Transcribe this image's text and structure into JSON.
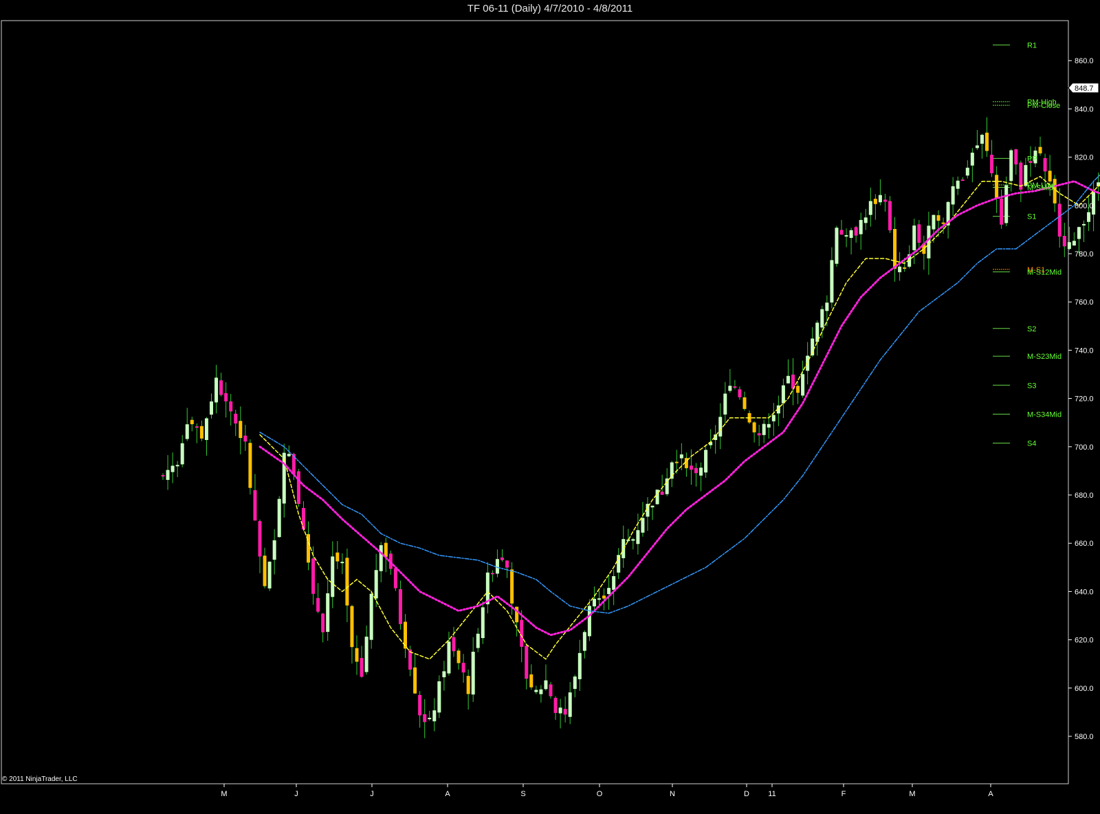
{
  "window": {
    "title": "TF 06-11 (Daily)  4/7/2010 - 4/8/2011",
    "copyright": "© 2011 NinjaTrader, LLC"
  },
  "colors": {
    "background": "#000000",
    "up_candle": "#c8ffc0",
    "down_candle_orange": "#ffc000",
    "down_candle_magenta": "#ff1ca8",
    "wick": "#33cc33",
    "sma_fast": "#ffff33",
    "sma_mid": "#ff22dd",
    "sma_slow": "#3399ff",
    "level_line": "#66dd44",
    "level_label": "#66ff33",
    "axis": "#ffffff"
  },
  "chart_data": {
    "type": "candlestick",
    "ylim": [
      570,
      878
    ],
    "y_ticks": [
      "580.0",
      "600.0",
      "620.0",
      "640.0",
      "660.0",
      "680.0",
      "700.0",
      "720.0",
      "740.0",
      "760.0",
      "780.0",
      "800.0",
      "820.0",
      "840.0",
      "860.0"
    ],
    "x_ticks": [
      "M",
      "J",
      "J",
      "A",
      "S",
      "O",
      "N",
      "D",
      "11",
      "F",
      "M",
      "A"
    ],
    "last_price": "848.7",
    "price_path": [
      [
        0,
        688
      ],
      [
        3,
        695
      ],
      [
        5,
        712
      ],
      [
        8,
        705
      ],
      [
        11,
        728
      ],
      [
        14,
        715
      ],
      [
        17,
        700
      ],
      [
        19,
        668
      ],
      [
        21,
        640
      ],
      [
        23,
        660
      ],
      [
        25,
        700
      ],
      [
        27,
        690
      ],
      [
        29,
        665
      ],
      [
        31,
        640
      ],
      [
        33,
        625
      ],
      [
        35,
        655
      ],
      [
        37,
        650
      ],
      [
        39,
        615
      ],
      [
        41,
        605
      ],
      [
        43,
        638
      ],
      [
        45,
        662
      ],
      [
        47,
        650
      ],
      [
        49,
        628
      ],
      [
        51,
        610
      ],
      [
        53,
        590
      ],
      [
        55,
        585
      ],
      [
        57,
        600
      ],
      [
        59,
        618
      ],
      [
        61,
        610
      ],
      [
        63,
        600
      ],
      [
        65,
        625
      ],
      [
        67,
        645
      ],
      [
        69,
        655
      ],
      [
        71,
        650
      ],
      [
        73,
        625
      ],
      [
        75,
        605
      ],
      [
        77,
        598
      ],
      [
        79,
        603
      ],
      [
        81,
        592
      ],
      [
        83,
        588
      ],
      [
        85,
        605
      ],
      [
        87,
        625
      ],
      [
        89,
        640
      ],
      [
        91,
        640
      ],
      [
        93,
        648
      ],
      [
        95,
        660
      ],
      [
        97,
        662
      ],
      [
        99,
        672
      ],
      [
        101,
        678
      ],
      [
        103,
        682
      ],
      [
        105,
        695
      ],
      [
        107,
        698
      ],
      [
        109,
        690
      ],
      [
        111,
        692
      ],
      [
        113,
        700
      ],
      [
        115,
        712
      ],
      [
        117,
        728
      ],
      [
        119,
        722
      ],
      [
        121,
        712
      ],
      [
        123,
        702
      ],
      [
        125,
        712
      ],
      [
        127,
        718
      ],
      [
        129,
        728
      ],
      [
        131,
        725
      ],
      [
        133,
        740
      ],
      [
        135,
        750
      ],
      [
        137,
        762
      ],
      [
        139,
        792
      ],
      [
        141,
        785
      ],
      [
        143,
        790
      ],
      [
        145,
        797
      ],
      [
        147,
        803
      ],
      [
        149,
        800
      ],
      [
        151,
        775
      ],
      [
        153,
        772
      ],
      [
        155,
        790
      ],
      [
        157,
        780
      ],
      [
        159,
        798
      ],
      [
        161,
        795
      ],
      [
        163,
        808
      ],
      [
        165,
        812
      ],
      [
        167,
        822
      ],
      [
        169,
        828
      ],
      [
        171,
        815
      ],
      [
        173,
        795
      ],
      [
        175,
        822
      ],
      [
        177,
        808
      ],
      [
        179,
        820
      ],
      [
        181,
        822
      ],
      [
        183,
        808
      ],
      [
        185,
        790
      ],
      [
        187,
        782
      ],
      [
        189,
        792
      ],
      [
        191,
        798
      ],
      [
        193,
        810
      ],
      [
        195,
        822
      ],
      [
        197,
        833
      ],
      [
        199,
        842
      ],
      [
        201,
        848
      ],
      [
        202,
        848.7
      ]
    ],
    "series": [
      {
        "name": "",
        "style": "dashed",
        "color": "#ffff33",
        "values": [
          [
            20,
            705
          ],
          [
            25,
            695
          ],
          [
            28,
            672
          ],
          [
            31,
            655
          ],
          [
            34,
            645
          ],
          [
            37,
            640
          ],
          [
            40,
            645
          ],
          [
            43,
            640
          ],
          [
            47,
            625
          ],
          [
            51,
            615
          ],
          [
            55,
            612
          ],
          [
            59,
            620
          ],
          [
            63,
            630
          ],
          [
            67,
            640
          ],
          [
            71,
            632
          ],
          [
            75,
            618
          ],
          [
            79,
            612
          ],
          [
            81,
            618
          ],
          [
            85,
            628
          ],
          [
            89,
            638
          ],
          [
            93,
            650
          ],
          [
            97,
            665
          ],
          [
            101,
            678
          ],
          [
            105,
            688
          ],
          [
            109,
            696
          ],
          [
            113,
            702
          ],
          [
            117,
            712
          ],
          [
            121,
            712
          ],
          [
            125,
            712
          ],
          [
            129,
            720
          ],
          [
            133,
            735
          ],
          [
            137,
            752
          ],
          [
            141,
            768
          ],
          [
            145,
            778
          ],
          [
            149,
            778
          ],
          [
            153,
            776
          ],
          [
            157,
            782
          ],
          [
            161,
            790
          ],
          [
            165,
            800
          ],
          [
            169,
            810
          ],
          [
            173,
            810
          ],
          [
            177,
            808
          ],
          [
            181,
            812
          ],
          [
            185,
            805
          ],
          [
            189,
            800
          ],
          [
            193,
            808
          ],
          [
            197,
            818
          ],
          [
            201,
            830
          ]
        ]
      },
      {
        "name": "",
        "style": "dotted",
        "color": "#ff22dd",
        "values": [
          [
            20,
            700
          ],
          [
            25,
            693
          ],
          [
            29,
            684
          ],
          [
            33,
            678
          ],
          [
            37,
            670
          ],
          [
            41,
            663
          ],
          [
            45,
            656
          ],
          [
            49,
            648
          ],
          [
            53,
            640
          ],
          [
            57,
            636
          ],
          [
            61,
            632
          ],
          [
            65,
            634
          ],
          [
            69,
            638
          ],
          [
            73,
            632
          ],
          [
            77,
            625
          ],
          [
            80,
            622
          ],
          [
            84,
            624
          ],
          [
            88,
            630
          ],
          [
            92,
            638
          ],
          [
            96,
            646
          ],
          [
            100,
            656
          ],
          [
            104,
            666
          ],
          [
            108,
            674
          ],
          [
            112,
            680
          ],
          [
            116,
            686
          ],
          [
            120,
            694
          ],
          [
            124,
            700
          ],
          [
            128,
            706
          ],
          [
            132,
            718
          ],
          [
            136,
            734
          ],
          [
            140,
            750
          ],
          [
            144,
            762
          ],
          [
            148,
            770
          ],
          [
            152,
            776
          ],
          [
            156,
            782
          ],
          [
            160,
            790
          ],
          [
            164,
            796
          ],
          [
            168,
            800
          ],
          [
            172,
            803
          ],
          [
            176,
            805
          ],
          [
            180,
            806
          ],
          [
            184,
            808
          ],
          [
            188,
            810
          ],
          [
            192,
            806
          ],
          [
            196,
            803
          ],
          [
            200,
            806
          ],
          [
            202,
            810
          ]
        ]
      },
      {
        "name": "",
        "style": "dash-dot",
        "color": "#3399ff",
        "values": [
          [
            20,
            706
          ],
          [
            25,
            700
          ],
          [
            29,
            692
          ],
          [
            33,
            684
          ],
          [
            37,
            676
          ],
          [
            41,
            672
          ],
          [
            45,
            664
          ],
          [
            49,
            660
          ],
          [
            53,
            658
          ],
          [
            57,
            655
          ],
          [
            61,
            654
          ],
          [
            65,
            653
          ],
          [
            69,
            650
          ],
          [
            73,
            648
          ],
          [
            77,
            645
          ],
          [
            80,
            640
          ],
          [
            84,
            634
          ],
          [
            88,
            632
          ],
          [
            92,
            631
          ],
          [
            96,
            634
          ],
          [
            100,
            638
          ],
          [
            104,
            642
          ],
          [
            108,
            646
          ],
          [
            112,
            650
          ],
          [
            116,
            656
          ],
          [
            120,
            662
          ],
          [
            124,
            670
          ],
          [
            128,
            678
          ],
          [
            132,
            688
          ],
          [
            136,
            700
          ],
          [
            140,
            712
          ],
          [
            144,
            724
          ],
          [
            148,
            736
          ],
          [
            152,
            746
          ],
          [
            156,
            756
          ],
          [
            160,
            762
          ],
          [
            164,
            768
          ],
          [
            168,
            776
          ],
          [
            172,
            782
          ],
          [
            176,
            782
          ],
          [
            180,
            788
          ],
          [
            184,
            794
          ],
          [
            188,
            800
          ],
          [
            192,
            810
          ],
          [
            196,
            818
          ],
          [
            200,
            826
          ],
          [
            202,
            830
          ]
        ]
      }
    ],
    "levels": [
      {
        "label": "R1",
        "value": 866.5
      },
      {
        "label": "PM-High",
        "value": 843
      },
      {
        "label": "PM-Close",
        "value": 841.5
      },
      {
        "label": "PP",
        "value": 819.5
      },
      {
        "label": "PM-Low",
        "value": 808.5
      },
      {
        "label": "M-SMid",
        "value": 807.5
      },
      {
        "label": "S1",
        "value": 795.5
      },
      {
        "label": "M-S1",
        "value": 773.5
      },
      {
        "label": "M-S12Mid",
        "value": 772.5
      },
      {
        "label": "S2",
        "value": 749
      },
      {
        "label": "M-S23Mid",
        "value": 737.5
      },
      {
        "label": "S3",
        "value": 725.5
      },
      {
        "label": "M-S34Mid",
        "value": 713.5
      },
      {
        "label": "S4",
        "value": 701.5
      }
    ]
  }
}
